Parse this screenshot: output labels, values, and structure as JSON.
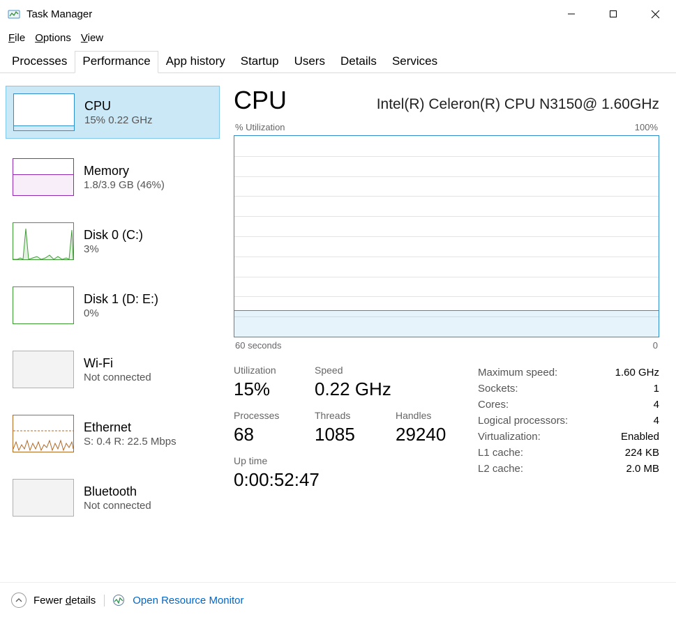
{
  "window": {
    "title": "Task Manager"
  },
  "menubar": {
    "file": "File",
    "options": "Options",
    "view": "View"
  },
  "tabs": {
    "processes": "Processes",
    "performance": "Performance",
    "app_history": "App history",
    "startup": "Startup",
    "users": "Users",
    "details": "Details",
    "services": "Services"
  },
  "sidebar": {
    "cpu": {
      "label": "CPU",
      "sub": "15%  0.22 GHz"
    },
    "memory": {
      "label": "Memory",
      "sub": "1.8/3.9 GB (46%)"
    },
    "disk0": {
      "label": "Disk 0 (C:)",
      "sub": "3%"
    },
    "disk1": {
      "label": "Disk 1 (D: E:)",
      "sub": "0%"
    },
    "wifi": {
      "label": "Wi-Fi",
      "sub": "Not connected"
    },
    "eth": {
      "label": "Ethernet",
      "sub": "S: 0.4  R: 22.5 Mbps"
    },
    "bt": {
      "label": "Bluetooth",
      "sub": "Not connected"
    }
  },
  "detail": {
    "title": "CPU",
    "model": "Intel(R) Celeron(R) CPU N3150@ 1.60GHz",
    "chart_top_left": "% Utilization",
    "chart_top_right": "100%",
    "chart_bot_left": "60 seconds",
    "chart_bot_right": "0",
    "utilization_label": "Utilization",
    "utilization_value": "15%",
    "speed_label": "Speed",
    "speed_value": "0.22 GHz",
    "processes_label": "Processes",
    "processes_value": "68",
    "threads_label": "Threads",
    "threads_value": "1085",
    "handles_label": "Handles",
    "handles_value": "29240",
    "uptime_label": "Up time",
    "uptime_value": "0:00:52:47",
    "info": {
      "max_speed_k": "Maximum speed:",
      "max_speed_v": "1.60 GHz",
      "sockets_k": "Sockets:",
      "sockets_v": "1",
      "cores_k": "Cores:",
      "cores_v": "4",
      "logical_k": "Logical processors:",
      "logical_v": "4",
      "virt_k": "Virtualization:",
      "virt_v": "Enabled",
      "l1_k": "L1 cache:",
      "l1_v": "224 KB",
      "l2_k": "L2 cache:",
      "l2_v": "2.0 MB"
    }
  },
  "bottom": {
    "fewer": "Fewer details",
    "open_rm": "Open Resource Monitor"
  },
  "chart_data": {
    "type": "line",
    "title": "% Utilization",
    "xlabel": "seconds",
    "ylabel": "% Utilization",
    "xlim": [
      60,
      0
    ],
    "ylim": [
      0,
      100
    ],
    "seconds_ago": [
      60,
      55,
      50,
      45,
      40,
      35,
      30,
      25,
      20,
      15,
      10,
      5,
      0
    ],
    "values": [
      13,
      13,
      12,
      13,
      13,
      13,
      13,
      13,
      12,
      13,
      13,
      13,
      13
    ]
  }
}
